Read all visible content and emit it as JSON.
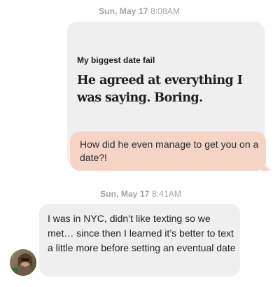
{
  "thread": {
    "timestamp_1": {
      "date": "Sun, May 17",
      "time": "8:08AM"
    },
    "prompt": {
      "label": "My biggest date fail",
      "answer": "He agreed at everything I was saying. Boring."
    },
    "reply": {
      "text": "How did he even manage to get you on a date?!"
    },
    "timestamp_2": {
      "date": "Sun, May 17",
      "time": "8:41AM"
    },
    "incoming": {
      "text": "I was in NYC, didn’t like texting so we met… since then I learned it’s better to text a little more before setting an eventual date"
    }
  },
  "colors": {
    "prompt_card_bg": "#efefef",
    "reply_bubble_bg": "#f6d4c5",
    "incoming_bubble_bg": "#efefef",
    "timestamp": "#9a9a9a"
  },
  "icons": {
    "avatar": "profile-photo-avatar"
  }
}
